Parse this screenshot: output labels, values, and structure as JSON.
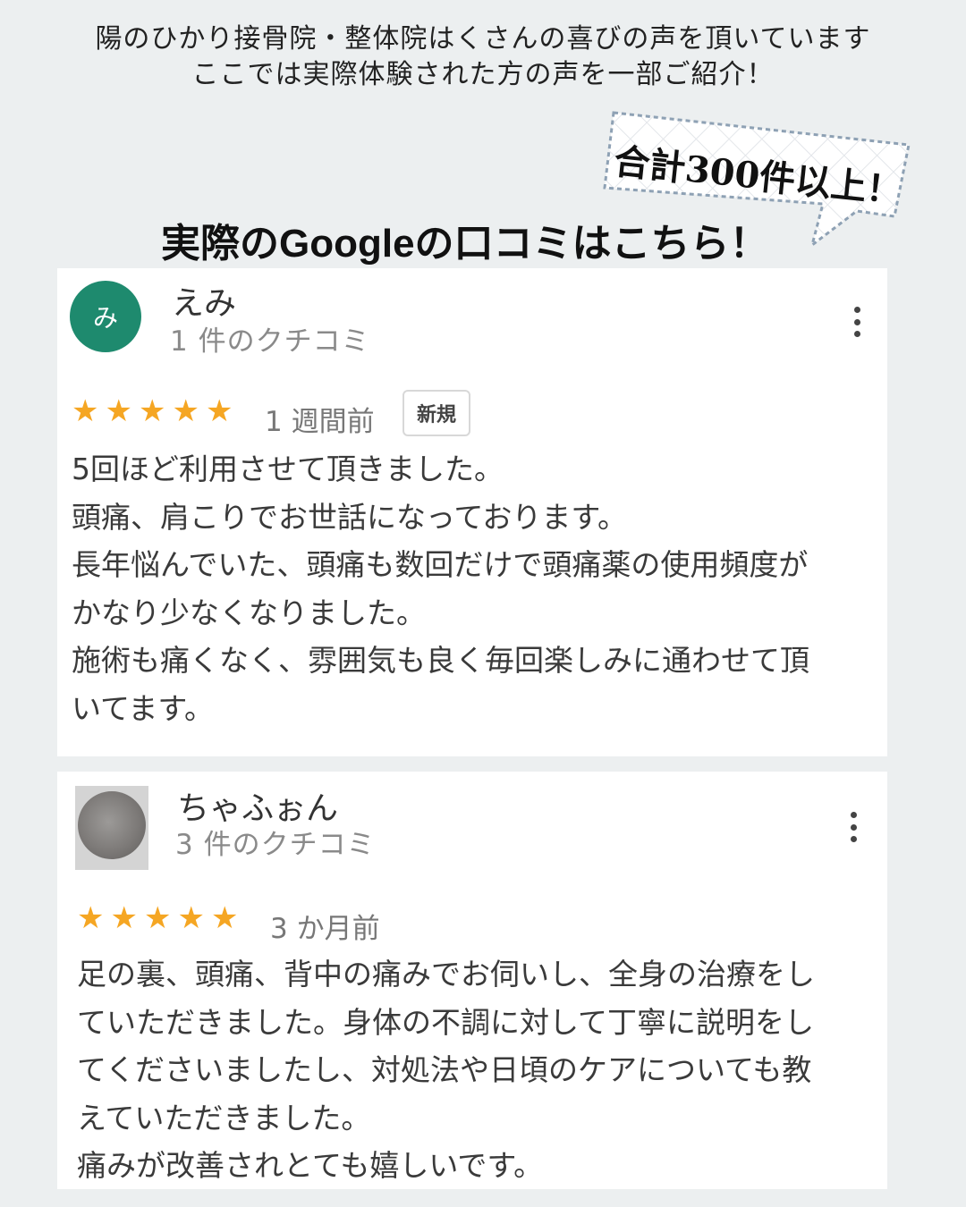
{
  "intro": {
    "line1": "陽のひかり接骨院・整体院はくさんの喜びの声を頂いています",
    "line2": "ここでは実際体験された方の声を一部ご紹介！"
  },
  "badge": {
    "text": "合計300件以上！"
  },
  "heading": "実際のGoogleの口コミはこちら！",
  "colors": {
    "background": "#eceff0",
    "star": "#f5a623",
    "avatar_green": "#1e8a6e"
  },
  "reviews": [
    {
      "avatar_initial": "み",
      "name": "えみ",
      "count": "1 件のクチコミ",
      "rating": 5,
      "date": "1 週間前",
      "tag": "新規",
      "lines": [
        "5回ほど利用させて頂きました。",
        "頭痛、肩こりでお世話になっております。",
        "長年悩んでいた、頭痛も数回だけで頭痛薬の使用頻度が",
        "かなり少なくなりました。",
        "施術も痛くなく、雰囲気も良く毎回楽しみに通わせて頂",
        "いてます。"
      ]
    },
    {
      "name": "ちゃふぉん",
      "count": "3 件のクチコミ",
      "rating": 5,
      "date": "3 か月前",
      "lines": [
        "足の裏、頭痛、背中の痛みでお伺いし、全身の治療をし",
        "ていただきました。身体の不調に対して丁寧に説明をし",
        "てくださいましたし、対処法や日頃のケアについても教",
        "えていただきました。",
        "痛みが改善されとても嬉しいです。"
      ]
    }
  ]
}
